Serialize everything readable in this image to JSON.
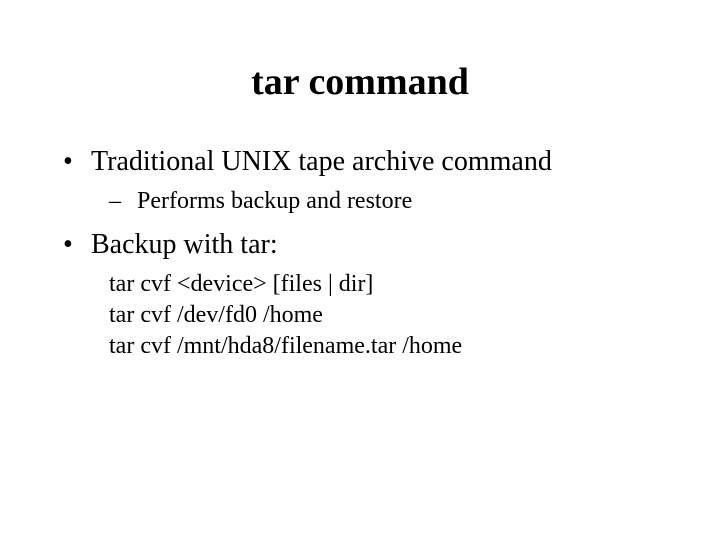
{
  "title": "tar command",
  "items": [
    {
      "text": "Traditional UNIX tape archive command",
      "sub": [
        "Performs backup and restore"
      ]
    },
    {
      "text": "Backup with tar:",
      "code": [
        "tar cvf  <device> [files | dir]",
        "tar cvf   /dev/fd0 /home",
        "tar cvf /mnt/hda8/filename.tar /home"
      ]
    }
  ]
}
